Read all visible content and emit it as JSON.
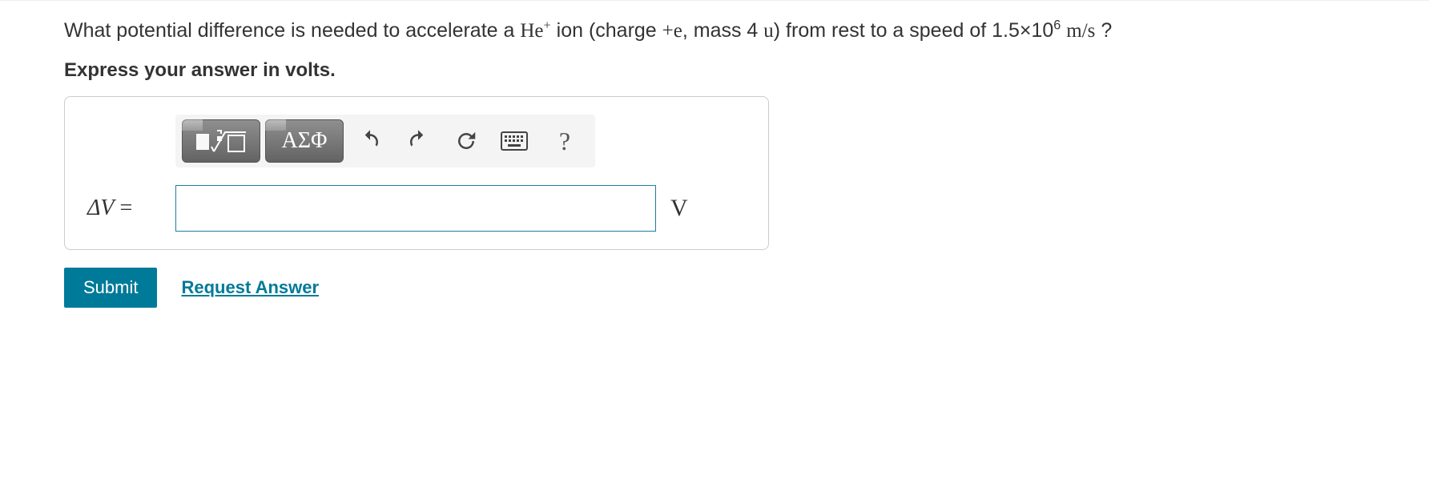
{
  "question": {
    "pre": "What potential difference is needed to accelerate a ",
    "ion": "He",
    "ion_sup": "+",
    "mid1": " ion (charge ",
    "charge": "+e",
    "mid2": ", mass 4 ",
    "mass_unit": "u",
    "mid3": ") from rest to a speed of 1.5×10",
    "exp": "6",
    "sp": " ",
    "units": "m/s",
    "end": " ?"
  },
  "instruction": "Express your answer in volts.",
  "toolbar": {
    "greek": "ΑΣΦ",
    "help": "?"
  },
  "answer": {
    "var": "ΔV",
    "eq": " = ",
    "value": "",
    "unit": "V"
  },
  "actions": {
    "submit": "Submit",
    "request": "Request Answer"
  }
}
